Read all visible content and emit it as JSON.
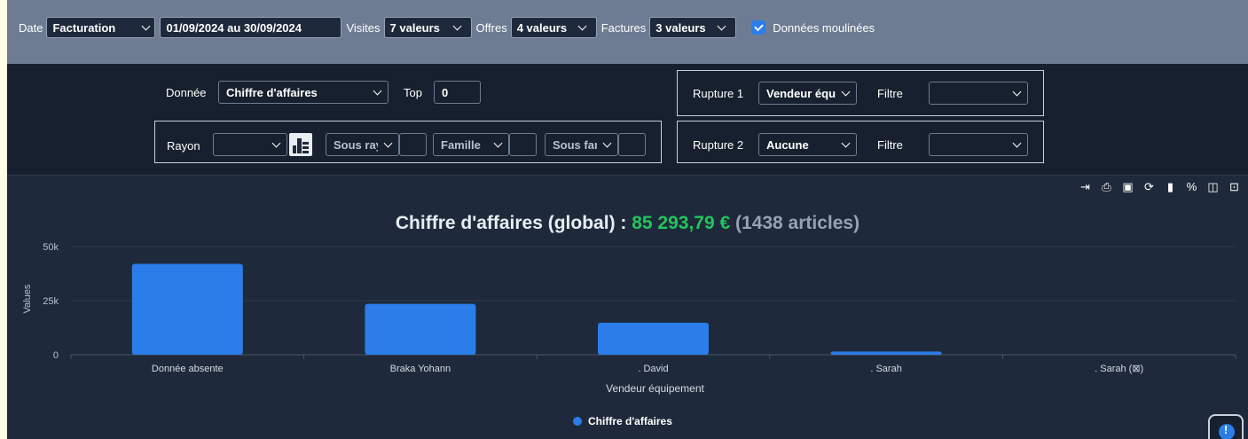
{
  "topbar": {
    "date_label": "Date",
    "date_type": "Facturation",
    "date_range": "01/09/2024 au 30/09/2024",
    "visites_label": "Visites",
    "visites_value": "7 valeurs",
    "offres_label": "Offres",
    "offres_value": "4 valeurs",
    "factures_label": "Factures",
    "factures_value": "3 valeurs",
    "moulinees_label": "Données moulinées",
    "moulinees_checked": true
  },
  "filters": {
    "donnee_label": "Donnée",
    "donnee_value": "Chiffre d'affaires",
    "top_label": "Top",
    "top_value": "0",
    "rayon_label": "Rayon",
    "rayon_value": "",
    "sous_rayon": "Sous rayon",
    "famille": "Famille",
    "sous_famille": "Sous famille",
    "rupture1_label": "Rupture 1",
    "rupture1_value": "Vendeur équipement",
    "filtre1_label": "Filtre",
    "rupture2_label": "Rupture 2",
    "rupture2_value": "Aucune",
    "filtre2_label": "Filtre"
  },
  "toolbar_icons": [
    "export-icon",
    "print-icon",
    "print-preview-icon",
    "refresh-icon",
    "bar-chart-icon",
    "percent-icon",
    "table-view-icon",
    "save-icon"
  ],
  "chart_title": {
    "prefix": "Chiffre d'affaires (global) :",
    "amount": "85 293,79 €",
    "count": "(1438 articles)"
  },
  "colors": {
    "bar": "#2b7de9",
    "amount": "#22c55e",
    "background": "#1e2a3b",
    "topbar": "#6d7c92"
  },
  "chart_data": {
    "type": "bar",
    "categories": [
      "Donnée absente",
      "Braka Yohann",
      ". David",
      ". Sarah",
      ". Sarah (⊠)"
    ],
    "series": [
      {
        "name": "Chiffre d'affaires",
        "values": [
          42000,
          23500,
          14800,
          1500,
          0
        ]
      }
    ],
    "xlabel": "Vendeur équipement",
    "ylabel": "Values",
    "yticks": [
      "0",
      "25k",
      "50k"
    ],
    "ylim": [
      0,
      50000
    ],
    "grid": true,
    "legend": "bottom-center"
  },
  "help_label": "!"
}
